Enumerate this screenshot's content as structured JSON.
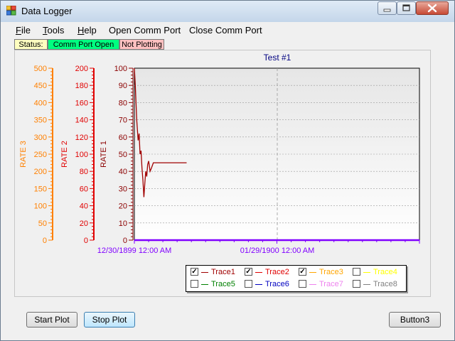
{
  "window": {
    "title": "Data Logger"
  },
  "menu": [
    "File",
    "Tools",
    "Help",
    "Open Comm Port",
    "Close Comm Port"
  ],
  "status": {
    "label": "Status:",
    "comm": "Comm Port Open",
    "plot": "Not Plotting",
    "colors": {
      "label_bg": "#ffffc0",
      "comm_bg": "#00ff80",
      "plot_bg": "#ffc0c0"
    }
  },
  "chart_data": {
    "type": "line",
    "title": "Test #1",
    "x_ticks": [
      "12/30/1899 12:00 AM",
      "01/29/1900 12:00 AM"
    ],
    "axes": [
      {
        "label": "RATE 1",
        "color": "#8b0000",
        "ticks": [
          "0",
          "10",
          "20",
          "30",
          "40",
          "50",
          "60",
          "70",
          "80",
          "90",
          "100"
        ],
        "range": [
          0,
          100
        ]
      },
      {
        "label": "RATE 2",
        "color": "#e00000",
        "ticks": [
          "0",
          "20",
          "40",
          "60",
          "80",
          "100",
          "120",
          "140",
          "160",
          "180",
          "200"
        ],
        "range": [
          0,
          200
        ]
      },
      {
        "label": "RATE 3",
        "color": "#ff8000",
        "ticks": [
          "0",
          "50",
          "100",
          "150",
          "200",
          "250",
          "300",
          "350",
          "400",
          "450",
          "500"
        ],
        "range": [
          0,
          500
        ]
      }
    ],
    "series": [
      {
        "name": "Trace1",
        "color": "#a00000",
        "points": [
          [
            0.0,
            100
          ],
          [
            0.2,
            90
          ],
          [
            0.5,
            70
          ],
          [
            0.8,
            58
          ],
          [
            1.0,
            62
          ],
          [
            1.2,
            50
          ],
          [
            1.4,
            52
          ],
          [
            1.6,
            42
          ],
          [
            1.8,
            35
          ],
          [
            2.0,
            25
          ],
          [
            2.2,
            33
          ],
          [
            2.4,
            40
          ],
          [
            2.6,
            37
          ],
          [
            2.8,
            44
          ],
          [
            3.0,
            46
          ],
          [
            3.3,
            40
          ],
          [
            3.6,
            42
          ],
          [
            4.0,
            45
          ],
          [
            5.0,
            45
          ],
          [
            8.0,
            45
          ],
          [
            11.0,
            45
          ]
        ]
      }
    ],
    "x_range": [
      0,
      60
    ],
    "purple_baseline_color": "#8000ff",
    "grid": true
  },
  "legend": [
    {
      "name": "Trace1",
      "checked": true,
      "color": "#a00000"
    },
    {
      "name": "Trace2",
      "checked": true,
      "color": "#e00000"
    },
    {
      "name": "Trace3",
      "checked": true,
      "color": "#ffa500"
    },
    {
      "name": "Trace4",
      "checked": false,
      "color": "#ffff00"
    },
    {
      "name": "Trace5",
      "checked": false,
      "color": "#008000"
    },
    {
      "name": "Trace6",
      "checked": false,
      "color": "#0000c0"
    },
    {
      "name": "Trace7",
      "checked": false,
      "color": "#ee82ee"
    },
    {
      "name": "Trace8",
      "checked": false,
      "color": "#808080"
    }
  ],
  "buttons": {
    "start": "Start Plot",
    "stop": "Stop Plot",
    "button3": "Button3"
  }
}
